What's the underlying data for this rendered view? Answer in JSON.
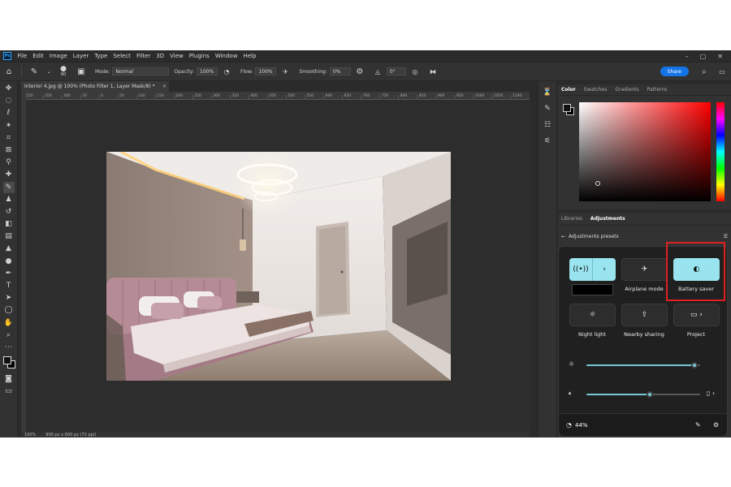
{
  "menubar": {
    "logo": "Ps",
    "items": [
      "File",
      "Edit",
      "Image",
      "Layer",
      "Type",
      "Select",
      "Filter",
      "3D",
      "View",
      "Plugins",
      "Window",
      "Help"
    ]
  },
  "optionsbar": {
    "brush_size": "80",
    "mode_label": "Mode:",
    "mode_value": "Normal",
    "opacity_label": "Opacity:",
    "opacity_value": "100%",
    "flow_label": "Flow:",
    "flow_value": "100%",
    "smoothing_label": "Smoothing:",
    "smoothing_value": "0%",
    "angle_value": "0°",
    "share_label": "Share"
  },
  "document": {
    "tab_title": "Interior 4.jpg @ 100% (Photo Filter 1, Layer Mask/8) *",
    "close": "×",
    "zoom": "100%",
    "dimensions": "900 px x 600 px (72 ppi)"
  },
  "ruler": {
    "labels": [
      "250",
      "350",
      "300",
      "50",
      "0",
      "50",
      "100",
      "150",
      "200",
      "250",
      "300",
      "350",
      "400",
      "450",
      "500",
      "550",
      "600",
      "650",
      "700",
      "750",
      "800",
      "850",
      "900",
      "950",
      "1000",
      "1050",
      "1100"
    ]
  },
  "color_panel": {
    "tabs": [
      "Color",
      "Swatches",
      "Gradients",
      "Patterns"
    ],
    "active_tab": "Color",
    "accent": "#ff0000"
  },
  "adjustments_panel": {
    "tabs": [
      "Libraries",
      "Adjustments"
    ],
    "active_tab": "Adjustments",
    "header": "Adjustments presets",
    "back_icon": "←",
    "menu_icon": "☰"
  },
  "quick_settings": {
    "tiles": [
      {
        "name": "wifi",
        "label": "",
        "on": true
      },
      {
        "name": "airplane-mode",
        "label": "Airplane mode",
        "on": false
      },
      {
        "name": "battery-saver",
        "label": "Battery saver",
        "on": true
      },
      {
        "name": "night-light",
        "label": "Night light",
        "on": false
      },
      {
        "name": "nearby-sharing",
        "label": "Nearby sharing",
        "on": false
      },
      {
        "name": "project",
        "label": "Project",
        "on": false
      }
    ],
    "brightness": 0.95,
    "volume": 0.56,
    "battery_percent": "44%",
    "accent": "#99e4ee",
    "highlight_color": "#e02020"
  }
}
